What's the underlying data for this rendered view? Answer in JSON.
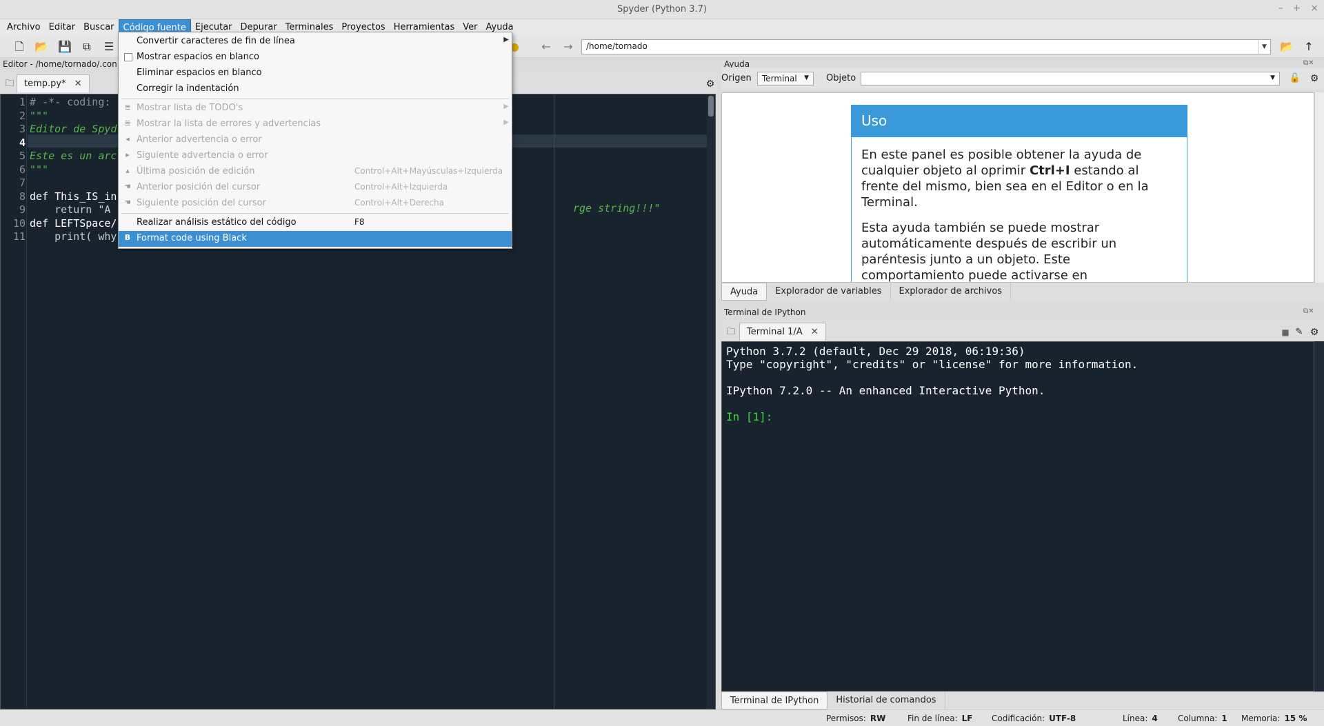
{
  "window": {
    "title": "Spyder (Python 3.7)"
  },
  "menubar": [
    "Archivo",
    "Editar",
    "Buscar",
    "Código fuente",
    "Ejecutar",
    "Depurar",
    "Terminales",
    "Proyectos",
    "Herramientas",
    "Ver",
    "Ayuda"
  ],
  "toolbar": {
    "path": "/home/tornado"
  },
  "editor": {
    "label": "Editor - /home/tornado/.con",
    "tab": "temp.py*",
    "line_numbers": [
      "1",
      "2",
      "3",
      "4",
      "5",
      "6",
      "7",
      "8",
      "9",
      "10",
      "11"
    ],
    "lines": [
      {
        "t": "# -*- coding:",
        "c": "#8a8f96"
      },
      {
        "t": "\"\"\"",
        "c": "#56b64a"
      },
      {
        "t": "Editor de Spyd",
        "c": "#56b64a"
      },
      {
        "t": "",
        "c": "#fff"
      },
      {
        "t": "Este es un arc",
        "c": "#56b64a"
      },
      {
        "t": "\"\"\"",
        "c": "#56b64a"
      },
      {
        "t": "",
        "c": "#fff"
      },
      {
        "t": "def This_IS_in",
        "c": "#ffffff"
      },
      {
        "t": "    return \"A",
        "c": "#c8ccd0"
      },
      {
        "t": "def LEFTSpace/",
        "c": "#ffffff"
      },
      {
        "t": "    print( why",
        "c": "#c8ccd0"
      }
    ],
    "overflow_text": "rge string!!!\""
  },
  "menu": {
    "items": [
      {
        "label": "Convertir caracteres de fin de línea",
        "shortcut": "",
        "state": "normal",
        "arrow": true,
        "icon": ""
      },
      {
        "label": "Mostrar espacios en blanco",
        "shortcut": "",
        "state": "normal",
        "arrow": false,
        "icon": "checkbox"
      },
      {
        "label": "Eliminar espacios en blanco",
        "shortcut": "",
        "state": "normal",
        "arrow": false,
        "icon": ""
      },
      {
        "label": "Corregir la indentación",
        "shortcut": "",
        "state": "normal",
        "arrow": false,
        "icon": ""
      },
      {
        "label": "Mostrar lista de TODO's",
        "shortcut": "",
        "state": "disabled",
        "arrow": true,
        "icon": "list"
      },
      {
        "label": "Mostrar la lista de errores y advertencias",
        "shortcut": "",
        "state": "disabled",
        "arrow": true,
        "icon": "list"
      },
      {
        "label": "Anterior advertencia o error",
        "shortcut": "",
        "state": "disabled",
        "arrow": false,
        "icon": "prev"
      },
      {
        "label": "Siguiente advertencia o error",
        "shortcut": "",
        "state": "disabled",
        "arrow": false,
        "icon": "next"
      },
      {
        "label": "Última posición de edición",
        "shortcut": "Control+Alt+Mayúsculas+Izquierda",
        "state": "disabled",
        "arrow": false,
        "icon": "up"
      },
      {
        "label": "Anterior posición del cursor",
        "shortcut": "Control+Alt+Izquierda",
        "state": "disabled",
        "arrow": false,
        "icon": "hand"
      },
      {
        "label": "Siguiente posición del cursor",
        "shortcut": "Control+Alt+Derecha",
        "state": "disabled",
        "arrow": false,
        "icon": "hand"
      },
      {
        "label": "Realizar análisis estático del código",
        "shortcut": "F8",
        "state": "normal",
        "arrow": false,
        "icon": ""
      },
      {
        "label": "Format code using Black",
        "shortcut": "",
        "state": "selected",
        "arrow": false,
        "icon": "B"
      }
    ]
  },
  "help": {
    "title": "Ayuda",
    "origin_label": "Origen",
    "origin_value": "Terminal",
    "object_label": "Objeto",
    "card_title": "Uso",
    "p1_a": "En este panel es posible obtener la ayuda de cualquier objeto al oprimir ",
    "p1_b": "Ctrl+I",
    "p1_c": " estando al frente del mismo, bien sea en el Editor o en la Terminal.",
    "p2": "Esta ayuda también se puede mostrar automáticamente después de escribir un paréntesis junto a un objeto. Este comportamiento puede activarse en",
    "tabs": [
      "Ayuda",
      "Explorador de variables",
      "Explorador de archivos"
    ]
  },
  "console": {
    "title": "Terminal de IPython",
    "tab": "Terminal 1/A",
    "lines": [
      "Python 3.7.2 (default, Dec 29 2018, 06:19:36)",
      "Type \"copyright\", \"credits\" or \"license\" for more information.",
      "",
      "IPython 7.2.0 -- An enhanced Interactive Python.",
      "",
      "In [1]:"
    ],
    "tabs": [
      "Terminal de IPython",
      "Historial de comandos"
    ]
  },
  "status": {
    "permisos_label": "Permisos:",
    "permisos": "RW",
    "fin_label": "Fin de línea:",
    "fin": "LF",
    "cod_label": "Codificación:",
    "cod": "UTF-8",
    "linea_label": "Línea:",
    "linea": "4",
    "col_label": "Columna:",
    "col": "1",
    "mem_label": "Memoria:",
    "mem": "15 %"
  },
  "colors": {
    "accent": "#3d8fd4",
    "editor_bg": "#19232d",
    "help_header": "#3a9ad9"
  }
}
